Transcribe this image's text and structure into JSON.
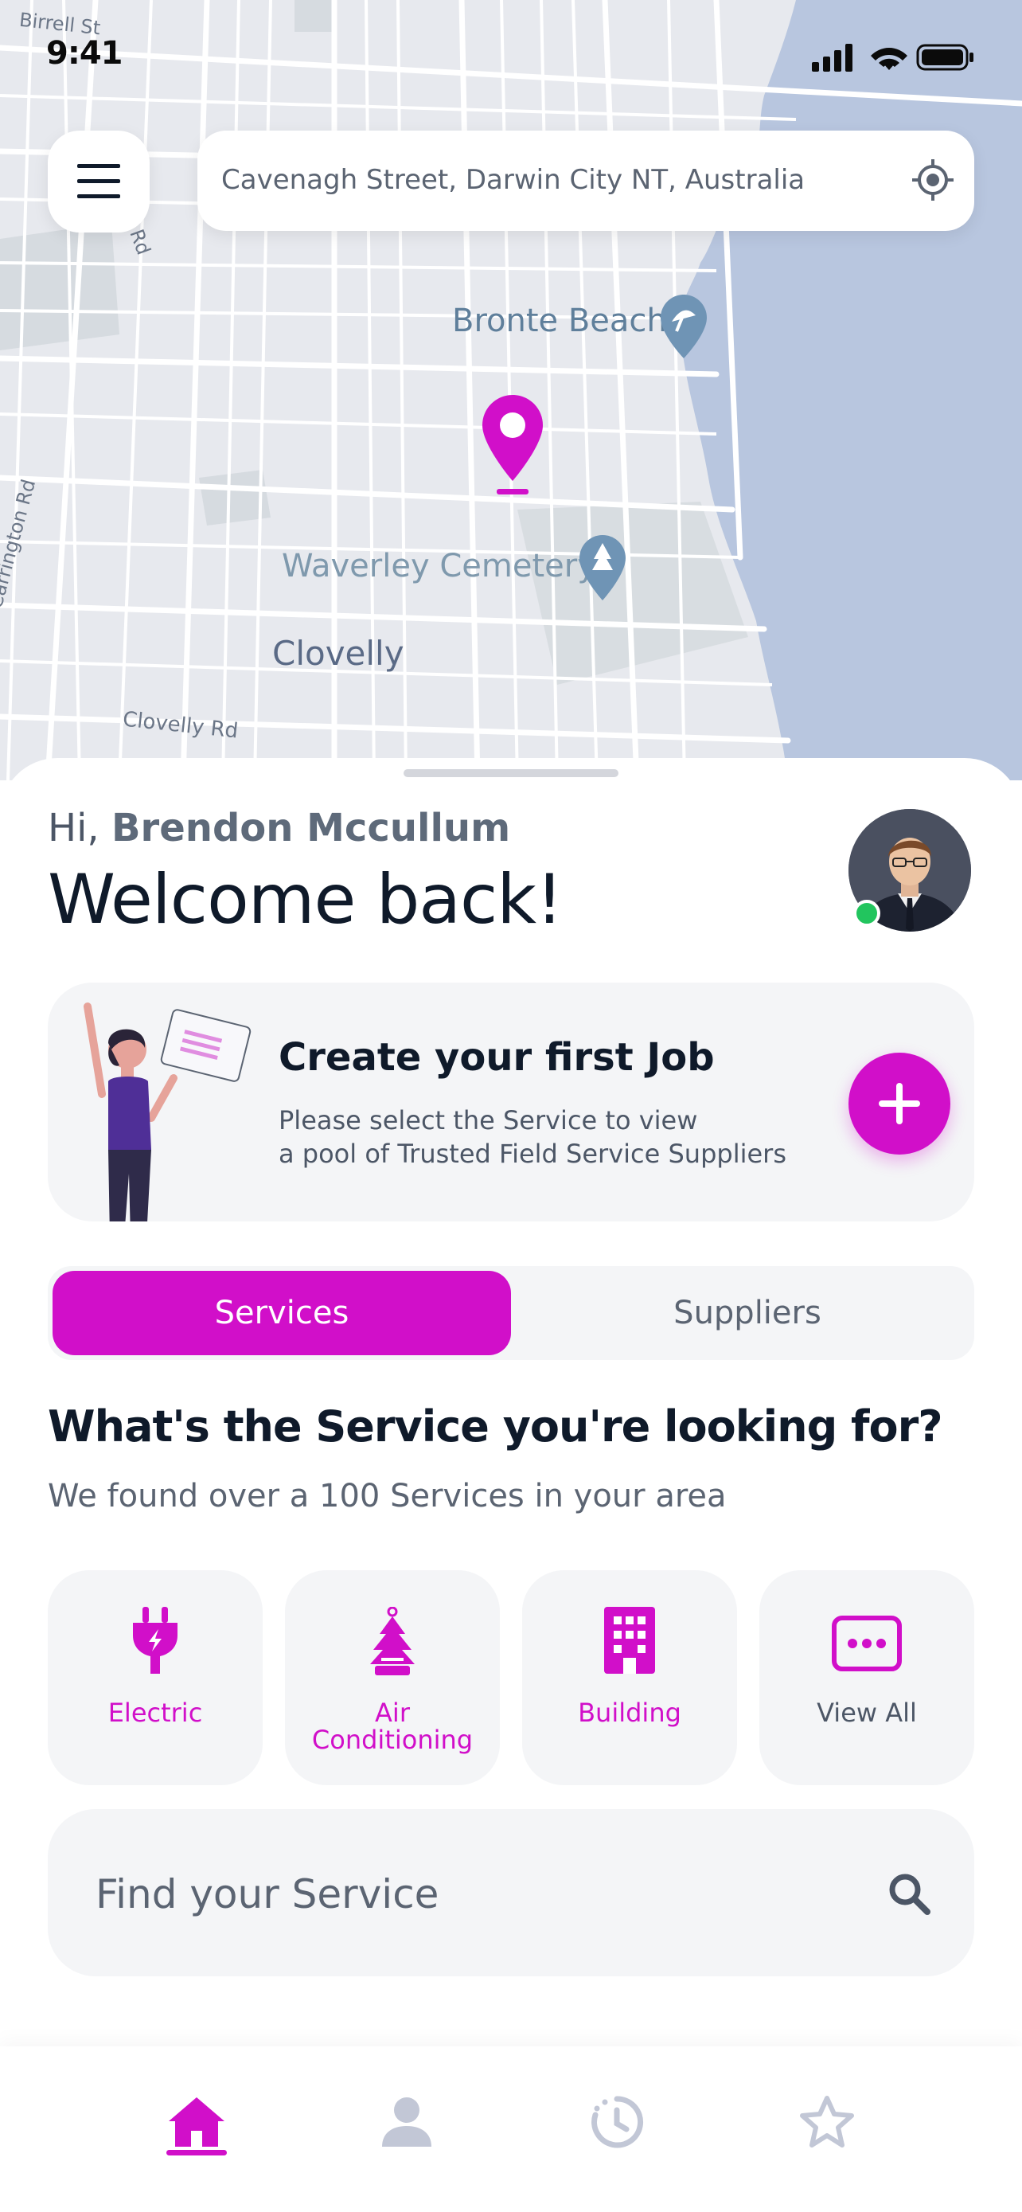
{
  "status_bar": {
    "time": "9:41"
  },
  "header": {
    "menu_icon": "hamburger-menu-icon",
    "search": {
      "address": "Cavenagh Street, Darwin City NT, Australia",
      "locate_icon": "crosshair-locate-icon"
    }
  },
  "map": {
    "labels": {
      "birrell_st": "Birrell St",
      "rd": "Rd",
      "bronte_beach": "Bronte Beach",
      "waverley_cemetery": "Waverley Cemetery",
      "clovelly": "Clovelly",
      "carrington_rd": "Carrington Rd",
      "clovelly_rd": "Clovelly Rd"
    },
    "pin_color": "#d10fc9"
  },
  "greeting": {
    "hi": "Hi,",
    "name": "Brendon Mccullum",
    "welcome": "Welcome back!"
  },
  "job_card": {
    "title": "Create your first Job",
    "subtitle_line1": "Please select the Service to view",
    "subtitle_line2": "a pool of Trusted Field Service Suppliers"
  },
  "tabs": [
    {
      "label": "Services",
      "active": true
    },
    {
      "label": "Suppliers",
      "active": false
    }
  ],
  "services_section": {
    "title": "What's the Service you're looking for?",
    "subtitle": "We found over a 100 Services in your area",
    "items": [
      {
        "label": "Electric",
        "icon": "plug-icon"
      },
      {
        "label_line1": "Air",
        "label_line2": "Conditioning",
        "icon": "air-freshener-icon"
      },
      {
        "label": "Building",
        "icon": "building-icon"
      },
      {
        "label": "View All",
        "icon": "more-dots-icon"
      }
    ]
  },
  "find_service": {
    "placeholder": "Find your Service",
    "icon": "search-icon"
  },
  "bottom_nav": [
    {
      "icon": "home-icon",
      "active": true
    },
    {
      "icon": "user-icon",
      "active": false
    },
    {
      "icon": "history-clock-icon",
      "active": false
    },
    {
      "icon": "star-icon",
      "active": false
    }
  ],
  "colors": {
    "accent": "#d10fc9",
    "text_dark": "#0f1a2a",
    "text_muted": "#5b6472",
    "card_bg": "#f4f5f7",
    "water": "#b8c6df",
    "online": "#22c55e"
  }
}
